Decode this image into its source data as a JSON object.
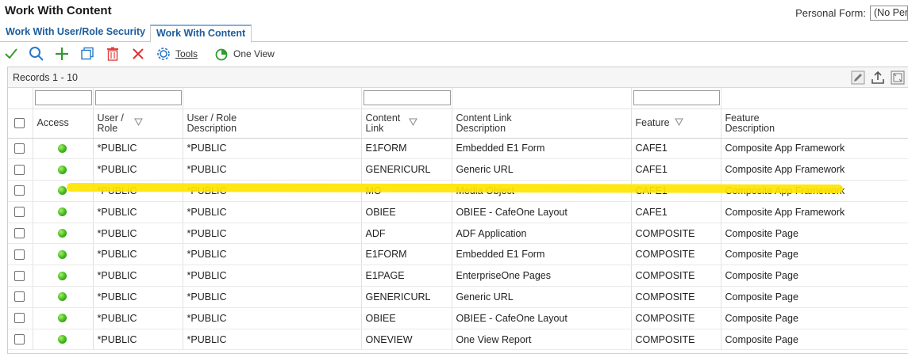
{
  "page": {
    "title": "Work With Content",
    "personal_form_label": "Personal Form:",
    "personal_form_value": "(No Personal Form)"
  },
  "tabs": [
    {
      "label": "Work With User/Role Security"
    },
    {
      "label": "Work With Content"
    }
  ],
  "toolbar": {
    "icons": [
      "check-icon",
      "search-icon",
      "add-icon",
      "copy-icon",
      "delete-icon",
      "close-icon"
    ],
    "tools_label": "Tools",
    "oneview_label": "One View"
  },
  "grid": {
    "records_label": "Records 1 - 10",
    "columns": {
      "access": "Access",
      "user_role": "User / Role",
      "user_role_desc": "User / Role Description",
      "content_link": "Content Link",
      "content_link_desc": "Content Link Description",
      "feature": "Feature",
      "feature_desc": "Feature Description"
    },
    "rows": [
      {
        "user": "*PUBLIC",
        "user_desc": "*PUBLIC",
        "link": "E1FORM",
        "link_desc": "Embedded E1 Form",
        "feature": "CAFE1",
        "feature_desc": "Composite App Framework"
      },
      {
        "user": "*PUBLIC",
        "user_desc": "*PUBLIC",
        "link": "GENERICURL",
        "link_desc": "Generic URL",
        "feature": "CAFE1",
        "feature_desc": "Composite App Framework"
      },
      {
        "user": "*PUBLIC",
        "user_desc": "*PUBLIC",
        "link": "MO",
        "link_desc": "Media Object",
        "feature": "CAFE1",
        "feature_desc": "Composite App Framework"
      },
      {
        "user": "*PUBLIC",
        "user_desc": "*PUBLIC",
        "link": "OBIEE",
        "link_desc": "OBIEE - CafeOne Layout",
        "feature": "CAFE1",
        "feature_desc": "Composite App Framework"
      },
      {
        "user": "*PUBLIC",
        "user_desc": "*PUBLIC",
        "link": "ADF",
        "link_desc": "ADF Application",
        "feature": "COMPOSITE",
        "feature_desc": "Composite Page"
      },
      {
        "user": "*PUBLIC",
        "user_desc": "*PUBLIC",
        "link": "E1FORM",
        "link_desc": "Embedded E1 Form",
        "feature": "COMPOSITE",
        "feature_desc": "Composite Page"
      },
      {
        "user": "*PUBLIC",
        "user_desc": "*PUBLIC",
        "link": "E1PAGE",
        "link_desc": "EnterpriseOne Pages",
        "feature": "COMPOSITE",
        "feature_desc": "Composite Page"
      },
      {
        "user": "*PUBLIC",
        "user_desc": "*PUBLIC",
        "link": "GENERICURL",
        "link_desc": "Generic URL",
        "feature": "COMPOSITE",
        "feature_desc": "Composite Page"
      },
      {
        "user": "*PUBLIC",
        "user_desc": "*PUBLIC",
        "link": "OBIEE",
        "link_desc": "OBIEE - CafeOne Layout",
        "feature": "COMPOSITE",
        "feature_desc": "Composite Page"
      },
      {
        "user": "*PUBLIC",
        "user_desc": "*PUBLIC",
        "link": "ONEVIEW",
        "link_desc": "One View Report",
        "feature": "COMPOSITE",
        "feature_desc": "Composite Page"
      }
    ]
  },
  "colors": {
    "access_dot": "#3fb71b",
    "tab_text": "#1c5c9b",
    "highlight": "#ffe500"
  }
}
